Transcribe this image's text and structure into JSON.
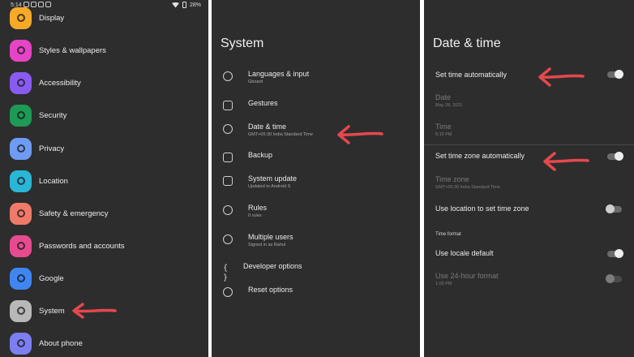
{
  "status_bar": {
    "time": "5:14",
    "battery": "28%"
  },
  "settings": {
    "items": [
      {
        "label": "Display",
        "color": "#f7a928",
        "icon": "display-icon"
      },
      {
        "label": "Styles & wallpapers",
        "color": "#e545c4",
        "icon": "palette-icon"
      },
      {
        "label": "Accessibility",
        "color": "#8a5bf2",
        "icon": "accessibility-icon"
      },
      {
        "label": "Security",
        "color": "#1d9a56",
        "icon": "lock-icon"
      },
      {
        "label": "Privacy",
        "color": "#6f9bf2",
        "icon": "eye-icon"
      },
      {
        "label": "Location",
        "color": "#2bb6d6",
        "icon": "location-pin-icon"
      },
      {
        "label": "Safety & emergency",
        "color": "#f07a6a",
        "icon": "asterisk-icon"
      },
      {
        "label": "Passwords and accounts",
        "color": "#e64b8f",
        "icon": "account-icon"
      },
      {
        "label": "Google",
        "color": "#3f86f3",
        "icon": "google-icon"
      },
      {
        "label": "System",
        "color": "#b8b8b8",
        "icon": "info-icon"
      },
      {
        "label": "About phone",
        "color": "#7d7ef0",
        "icon": "phone-icon"
      }
    ]
  },
  "system": {
    "title": "System",
    "items": [
      {
        "label": "Languages & input",
        "sub": "Gboard",
        "icon": "globe-icon"
      },
      {
        "label": "Gestures",
        "sub": "",
        "icon": "gesture-phone-icon"
      },
      {
        "label": "Date & time",
        "sub": "GMT+05:30 India Standard Time",
        "icon": "clock-icon"
      },
      {
        "label": "Backup",
        "sub": "",
        "icon": "cloud-upload-icon"
      },
      {
        "label": "System update",
        "sub": "Updated to Android S",
        "icon": "system-update-icon"
      },
      {
        "label": "Rules",
        "sub": "0 rules",
        "icon": "rules-icon"
      },
      {
        "label": "Multiple users",
        "sub": "Signed in as Rahul",
        "icon": "person-icon"
      },
      {
        "label": "Developer options",
        "sub": "",
        "icon": "braces-icon"
      },
      {
        "label": "Reset options",
        "sub": "",
        "icon": "history-icon"
      }
    ]
  },
  "datetime": {
    "title": "Date & time",
    "set_time_auto": {
      "label": "Set time automatically",
      "on": true
    },
    "date": {
      "label": "Date",
      "value": "May 28, 2021"
    },
    "time": {
      "label": "Time",
      "value": "5:15 PM"
    },
    "set_zone_auto": {
      "label": "Set time zone automatically",
      "on": true
    },
    "time_zone": {
      "label": "Time zone",
      "value": "GMT+05:30 India Standard Time"
    },
    "use_location": {
      "label": "Use location to set time zone",
      "on": false
    },
    "time_format_header": "Time format",
    "use_locale": {
      "label": "Use locale default",
      "on": true
    },
    "use_24h": {
      "label": "Use 24-hour format",
      "value": "1:00 PM",
      "on": false
    }
  },
  "colors": {
    "panel_bg": "#2d2d2d",
    "annotation_arrow": "#e5484d"
  }
}
